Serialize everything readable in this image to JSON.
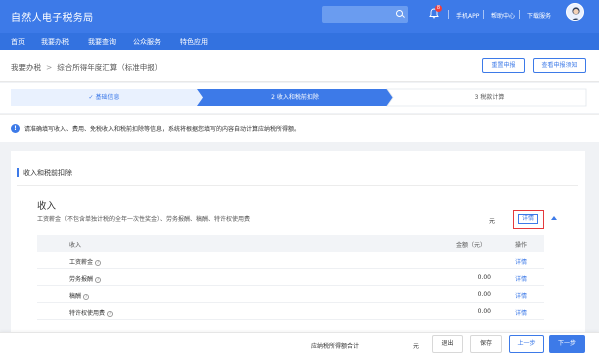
{
  "header": {
    "title": "自然人电子税务局",
    "notification_count": "8",
    "links": [
      "手机APP",
      "帮助中心",
      "下载服务"
    ]
  },
  "nav": [
    "首页",
    "我要办税",
    "我要查询",
    "公众服务",
    "特色应用"
  ],
  "breadcrumb": {
    "parent": "我要办税",
    "current": "综合所得年度汇算（标准申报）"
  },
  "actions": {
    "reset": "重置申报",
    "view_notice": "查看申报须知"
  },
  "steps": [
    {
      "label": "基础信息",
      "state": "done"
    },
    {
      "label": "2 收入和税前扣除",
      "state": "active"
    },
    {
      "label": "3 税款计算",
      "state": "pending"
    }
  ],
  "info_text": "请准确填写收入、费用、免税收入和税前扣除等信息，系统将根据您填写的内容自动计算应纳税所得额。",
  "section_title": "收入和税前扣除",
  "income": {
    "title": "收入",
    "subtitle": "工资薪金（不包含单独计税的全年一次性奖金）、劳务报酬、稿酬、特许权使用费",
    "unit": "元",
    "detail_label": "详情"
  },
  "table": {
    "columns": [
      "收入",
      "金额（元）",
      "操作"
    ],
    "rows": [
      {
        "name": "工资薪金",
        "amount": "",
        "action": "详情"
      },
      {
        "name": "劳务报酬",
        "amount": "0.00",
        "action": "详情"
      },
      {
        "name": "稿酬",
        "amount": "0.00",
        "action": "详情"
      },
      {
        "name": "特许权使用费",
        "amount": "0.00",
        "action": "详情"
      }
    ]
  },
  "footer": {
    "total_label": "应纳税所得额合计",
    "unit": "元",
    "exit": "退出",
    "save": "保存",
    "prev": "上一步",
    "next": "下一步"
  },
  "colors": {
    "primary": "#3d7ae8",
    "highlight": "#e4393c"
  }
}
